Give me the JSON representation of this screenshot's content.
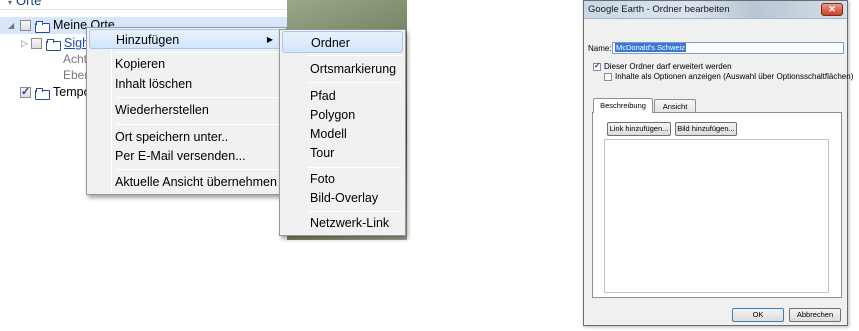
{
  "places": {
    "header": "Orte",
    "items": [
      {
        "label": "Meine Orte"
      },
      {
        "label": "Sigh"
      },
      {
        "label": "Acht"
      },
      {
        "label": "Eber"
      },
      {
        "label": "Tempo"
      }
    ]
  },
  "context_menu": {
    "items": [
      {
        "label": "Hinzufügen"
      },
      {
        "label": "Kopieren"
      },
      {
        "label": "Inhalt löschen"
      },
      {
        "label": "Wiederherstellen"
      },
      {
        "label": "Ort speichern unter.."
      },
      {
        "label": "Per E-Mail versenden..."
      },
      {
        "label": "Aktuelle Ansicht übernehmen"
      }
    ]
  },
  "sub_menu": {
    "items": [
      {
        "label": "Ordner"
      },
      {
        "label": "Ortsmarkierung"
      },
      {
        "label": "Pfad"
      },
      {
        "label": "Polygon"
      },
      {
        "label": "Modell"
      },
      {
        "label": "Tour"
      },
      {
        "label": "Foto"
      },
      {
        "label": "Bild-Overlay"
      },
      {
        "label": "Netzwerk-Link"
      }
    ]
  },
  "dialog": {
    "title": "Google Earth - Ordner bearbeiten",
    "close_label": "✕",
    "name_label": "Name:",
    "name_value": "McDonald's Schweiz",
    "checkbox_expand": "Dieser Ordner darf erweitert werden",
    "checkbox_options": "Inhalte als Optionen anzeigen (Auswahl über Optionsschaltflächen)",
    "tabs": [
      {
        "label": "Beschreibung"
      },
      {
        "label": "Ansicht"
      }
    ],
    "add_link_button": "Link hinzufügen...",
    "add_image_button": "Bild hinzufügen...",
    "ok_button": "OK",
    "cancel_button": "Abbrechen"
  }
}
